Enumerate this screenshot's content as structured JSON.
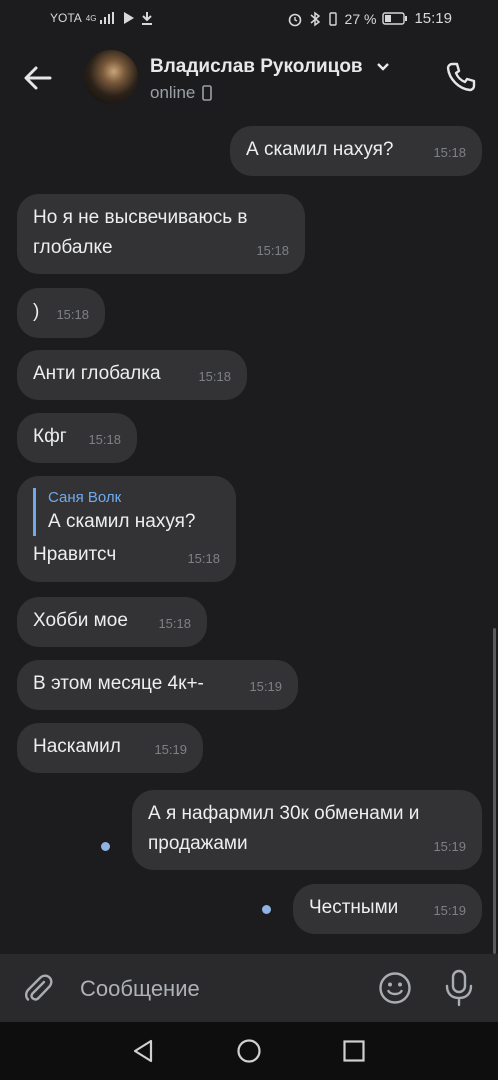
{
  "statusbar": {
    "carrier": "YOTA",
    "net": "4G",
    "battery": "27 %",
    "time": "15:19"
  },
  "header": {
    "name": "Владислав Руколицов",
    "status": "online",
    "back_icon": "arrow-left-icon",
    "call_icon": "phone-icon"
  },
  "messages": [
    {
      "text": "А скамил нахуя?",
      "time": "15:18",
      "out": true
    },
    {
      "text": "Но я не высвечиваюсь в",
      "text2": "глобалке",
      "time": "15:18",
      "out": false
    },
    {
      "text": ")",
      "time": "15:18",
      "out": false
    },
    {
      "text": "Анти глобалка",
      "time": "15:18",
      "out": false
    },
    {
      "text": "Кфг",
      "time": "15:18",
      "out": false
    },
    {
      "reply_name": "Саня Волк",
      "reply_text": "А скамил нахуя?",
      "text": "Нравитсч",
      "time": "15:18",
      "out": false
    },
    {
      "text": "Хобби мое",
      "time": "15:18",
      "out": false
    },
    {
      "text": "В этом месяце 4к+-",
      "time": "15:19",
      "out": false
    },
    {
      "text": "Наскамил",
      "time": "15:19",
      "out": false
    },
    {
      "text": "А я нафармил 30к обменами и",
      "text2": "продажами",
      "time": "15:19",
      "out": true
    },
    {
      "text": "Честными",
      "time": "15:19",
      "out": true
    }
  ],
  "composer": {
    "placeholder": "Сообщение"
  },
  "colors": {
    "background": "#1c1c1e",
    "bubble": "#333335",
    "accent": "#71aaeb",
    "unread_dot": "#8fb4e3"
  }
}
